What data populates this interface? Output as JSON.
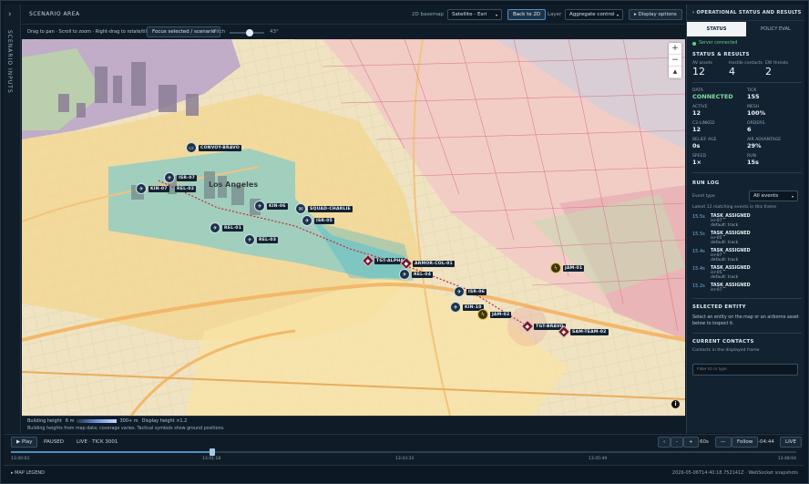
{
  "left_rail": {
    "label": "SCENARIO INPUTS",
    "toggle": "›"
  },
  "topbar": {
    "title": "SCENARIO AREA",
    "basemap_label": "2D basemap",
    "basemap_value": "Satellite - Esri",
    "back_button": "Back to 2D",
    "layer_label": "Layer",
    "layer_value": "Aggregate control",
    "display_button": "▸ Display options"
  },
  "subbar": {
    "hint": "Drag to pan · Scroll to zoom · Right-drag to rotate/tilt",
    "focus_button": "Focus selected / scenario",
    "pitch_label": "Pitch",
    "pitch_value": "43°"
  },
  "map": {
    "zoom_in": "+",
    "zoom_out": "−",
    "compass": "▴",
    "info": "i",
    "place_label": "Los Angeles",
    "units": [
      {
        "label": "CONVOY-BRAVO",
        "glyph": "▭"
      },
      {
        "label": "ISR-07",
        "glyph": "✈"
      },
      {
        "label": "KIN-07",
        "glyph": "✈"
      },
      {
        "label": "REL-02",
        "glyph": "✈"
      },
      {
        "label": "KIN-06",
        "glyph": "✈"
      },
      {
        "label": "SQUAD-CHARLIE",
        "glyph": "✉"
      },
      {
        "label": "ISR-05",
        "glyph": "✈"
      },
      {
        "label": "REL-01",
        "glyph": "✈"
      },
      {
        "label": "REL-03",
        "glyph": "✈"
      },
      {
        "label": "TGT-ALPHA",
        "glyph": "◆"
      },
      {
        "label": "ARMOR-COL-01",
        "glyph": "◆"
      },
      {
        "label": "REL-04",
        "glyph": "✈"
      },
      {
        "label": "ISR-06",
        "glyph": "✈"
      },
      {
        "label": "KIN-10",
        "glyph": "✈"
      },
      {
        "label": "JAM-02",
        "glyph": "ϟ"
      },
      {
        "label": "JAM-01",
        "glyph": "ϟ"
      },
      {
        "label": "TGT-BRAVO",
        "glyph": "◆"
      },
      {
        "label": "SAM-TEAM-02",
        "glyph": "◆"
      }
    ]
  },
  "legend": {
    "building_label": "Building height",
    "min_label": "6 m",
    "max_label": "300+ m",
    "display_height": "Display height ×1.2",
    "note": "Building heights from map data; coverage varies. Tactical symbols show ground positions."
  },
  "playback": {
    "play": "▶ Play",
    "state": "PAUSED",
    "live_tick": "LIVE · TICK 3001",
    "prev": "‹",
    "minus": "-",
    "plus": "+",
    "speed": "60s",
    "dash": "—",
    "follow": "Follow",
    "offset": "-04:44",
    "live_button": "LIVE"
  },
  "timeline": {
    "ticks": [
      "13:40:03",
      "13:41:18",
      "13:43:33",
      "13:45:49",
      "13:48:04"
    ],
    "position": 0.256
  },
  "footer": {
    "legend": "▸ MAP LEGEND",
    "timestamp": "2026-05-06T14:40:18.752141Z · WebSocket snapshots"
  },
  "right_panel": {
    "header": "› OPERATIONAL STATUS AND RESULTS",
    "tabs": [
      "STATUS",
      "POLICY EVAL"
    ],
    "server": "Server connected",
    "status_title": "STATUS & RESULTS",
    "counts": [
      {
        "k": "AV assets",
        "v": "12"
      },
      {
        "k": "Hostile contacts",
        "v": "4"
      },
      {
        "k": "EW threats",
        "v": "2"
      }
    ],
    "metrics": [
      {
        "k": "DATA",
        "v": "CONNECTED"
      },
      {
        "k": "TICK",
        "v": "155"
      },
      {
        "k": "ACTIVE",
        "v": "12"
      },
      {
        "k": "MESH",
        "v": "100%"
      },
      {
        "k": "C2-LINKED",
        "v": "12"
      },
      {
        "k": "ORDERS",
        "v": "6"
      },
      {
        "k": "BELIEF AGE",
        "v": "0s"
      },
      {
        "k": "AIR ADVANTAGE",
        "v": "29%"
      },
      {
        "k": "SPEED",
        "v": "1×"
      },
      {
        "k": "RUN",
        "v": "15s"
      }
    ],
    "run_log_title": "RUN LOG",
    "event_type_label": "Event type",
    "event_type_value": "All events",
    "run_log_note": "Latest 12 matching events in this frame",
    "events": [
      {
        "t": "15.5s",
        "e": "TASK_ASSIGNED",
        "a": "isr-07",
        "b": "default: track"
      },
      {
        "t": "15.5s",
        "e": "TASK_ASSIGNED",
        "a": "isr-05",
        "b": "default: track"
      },
      {
        "t": "15.4s",
        "e": "TASK_ASSIGNED",
        "a": "isr-07",
        "b": "default: track"
      },
      {
        "t": "15.4s",
        "e": "TASK_ASSIGNED",
        "a": "isr-05",
        "b": "default: track"
      },
      {
        "t": "15.2s",
        "e": "TASK_ASSIGNED",
        "a": "isr-07",
        "b": ""
      }
    ],
    "selected_title": "SELECTED ENTITY",
    "selected_text": "Select an entity on the map or an airborne asset below to inspect it.",
    "contacts_title": "CURRENT CONTACTS",
    "contacts_note": "Contacts in the displayed frame",
    "filter_placeholder": "Filter ID or type"
  },
  "colors": {
    "accent": "#4f8fc0",
    "panel": "#132230",
    "connected": "#7fe0a4",
    "threat": "#6b1d2a",
    "ew": "#e8c35a"
  }
}
